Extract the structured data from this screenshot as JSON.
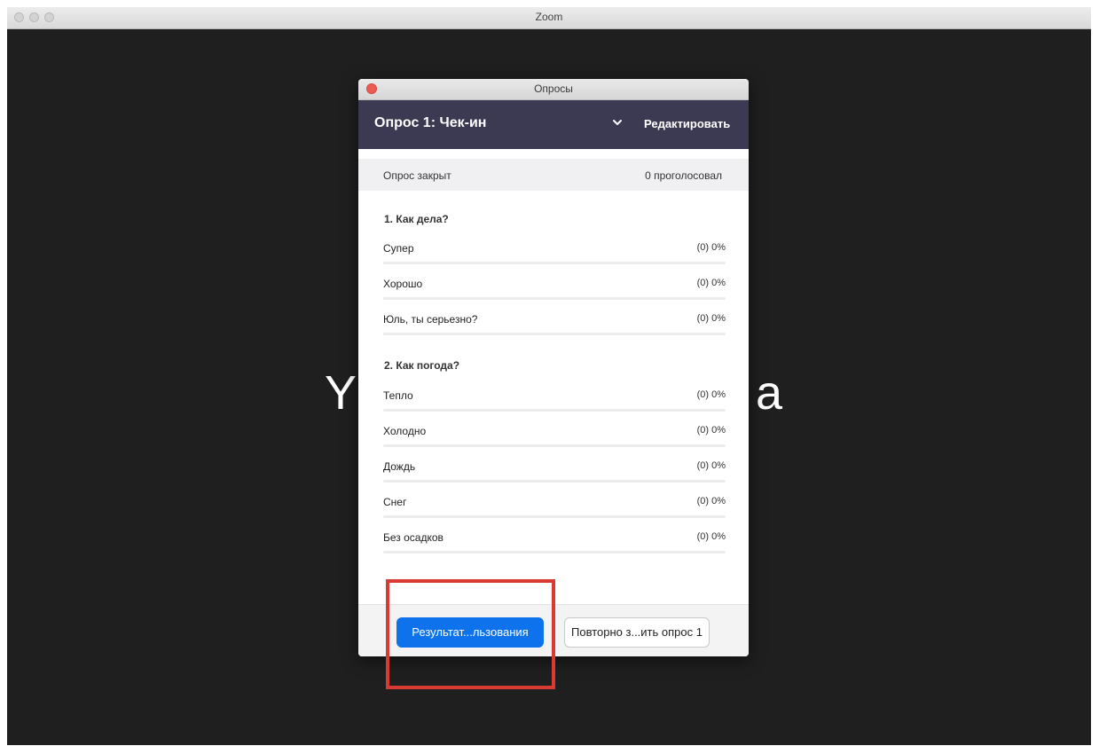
{
  "app": {
    "window_title": "Zoom",
    "background_text_left": "Y",
    "background_text_right": "a"
  },
  "dialog": {
    "title": "Опросы",
    "poll_name": "Опрос 1: Чек-ин",
    "edit_label": "Редактировать",
    "status": "Опрос закрыт",
    "votes": "0 проголосовал",
    "questions": [
      {
        "title": "1. Как дела?",
        "answers": [
          {
            "text": "Супер",
            "result": "(0) 0%",
            "percent": 0
          },
          {
            "text": "Хорошо",
            "result": "(0) 0%",
            "percent": 0
          },
          {
            "text": "Юль, ты серьезно?",
            "result": "(0) 0%",
            "percent": 0
          }
        ]
      },
      {
        "title": "2. Как погода?",
        "answers": [
          {
            "text": "Тепло",
            "result": "(0) 0%",
            "percent": 0
          },
          {
            "text": "Холодно",
            "result": "(0) 0%",
            "percent": 0
          },
          {
            "text": "Дождь",
            "result": "(0) 0%",
            "percent": 0
          },
          {
            "text": "Снег",
            "result": "(0) 0%",
            "percent": 0
          },
          {
            "text": "Без осадков",
            "result": "(0) 0%",
            "percent": 0
          }
        ]
      }
    ],
    "footer": {
      "results_button": "Результат...льзования",
      "relaunch_button": "Повторно з...ить опрос 1"
    }
  },
  "colors": {
    "header_bg": "#3c3953",
    "primary_button": "#0e72ed",
    "highlight": "#d93a34",
    "close_button": "#ec5b52"
  },
  "icons": {
    "dropdown": "chevron-down-icon",
    "close": "close-icon"
  }
}
